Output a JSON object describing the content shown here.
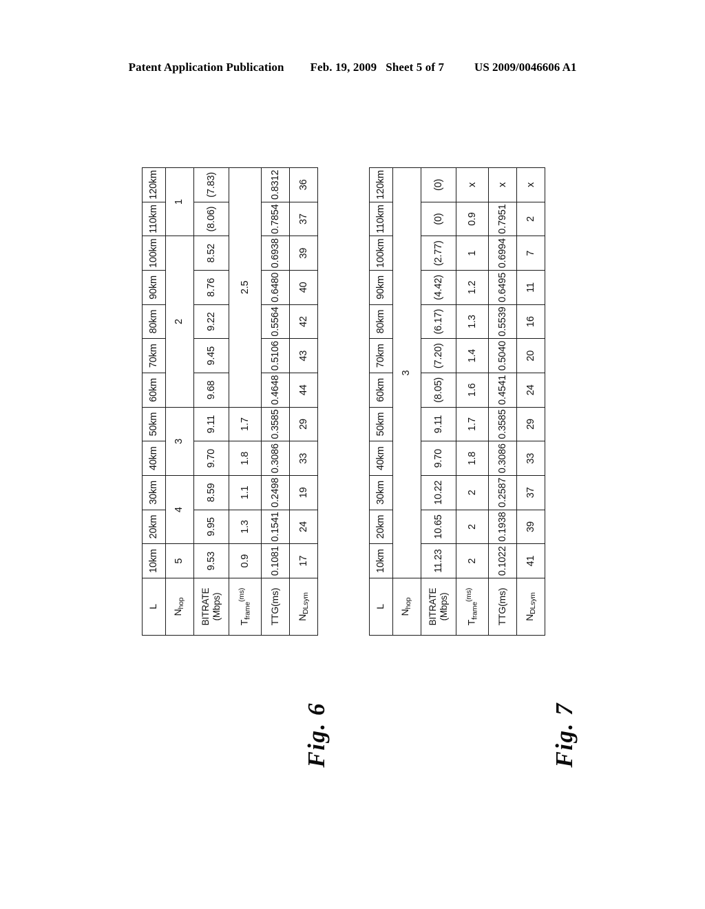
{
  "header": {
    "publication": "Patent Application Publication",
    "date": "Feb. 19, 2009",
    "sheet": "Sheet 5 of 7",
    "number": "US 2009/0046606 A1"
  },
  "figures": [
    {
      "id": "fig6",
      "caption": "Fig. 6",
      "corner_label": "L",
      "columns": [
        "10km",
        "20km",
        "30km",
        "40km",
        "50km",
        "60km",
        "70km",
        "80km",
        "90km",
        "100km",
        "110km",
        "120km"
      ],
      "rows": [
        {
          "key": "nhop",
          "label_main": "N",
          "label_sub": "hop",
          "label_sup": "",
          "merged": true,
          "cells": [
            {
              "value": "5",
              "span": 1
            },
            {
              "value": "4",
              "span": 2
            },
            {
              "value": "3",
              "span": 2
            },
            {
              "value": "2",
              "span": 5
            },
            {
              "value": "1",
              "span": 2
            }
          ]
        },
        {
          "key": "bitrate",
          "label_main": "BITRATE",
          "label_sub": "",
          "label_line2": "(Mbps)",
          "merged": false,
          "values": [
            "9.53",
            "9.95",
            "8.59",
            "9.70",
            "9.11",
            "9.68",
            "9.45",
            "9.22",
            "8.76",
            "8.52",
            "(8.06)",
            "(7.83)"
          ]
        },
        {
          "key": "tframe",
          "label_main": "T",
          "label_sub": "frame",
          "label_sup": "(ms)",
          "merged": true,
          "cells": [
            {
              "value": "0.9",
              "span": 1
            },
            {
              "value": "1.3",
              "span": 1
            },
            {
              "value": "1.1",
              "span": 1
            },
            {
              "value": "1.8",
              "span": 1
            },
            {
              "value": "1.7",
              "span": 1
            },
            {
              "value": "2.5",
              "span": 7
            }
          ]
        },
        {
          "key": "ttg",
          "label_main": "TTG(ms)",
          "label_sub": "",
          "merged": false,
          "values": [
            "0.1081",
            "0.1541",
            "0.2498",
            "0.3086",
            "0.3585",
            "0.4648",
            "0.5106",
            "0.5564",
            "0.6480",
            "0.6938",
            "0.7854",
            "0.8312"
          ]
        },
        {
          "key": "ndlsym",
          "label_main": "N",
          "label_sub": "DLsym",
          "merged": false,
          "values": [
            "17",
            "24",
            "19",
            "33",
            "29",
            "44",
            "43",
            "42",
            "40",
            "39",
            "37",
            "36"
          ]
        }
      ]
    },
    {
      "id": "fig7",
      "caption": "Fig. 7",
      "corner_label": "L",
      "columns": [
        "10km",
        "20km",
        "30km",
        "40km",
        "50km",
        "60km",
        "70km",
        "80km",
        "90km",
        "100km",
        "110km",
        "120km"
      ],
      "rows": [
        {
          "key": "nhop",
          "label_main": "N",
          "label_sub": "hop",
          "label_sup": "",
          "merged": true,
          "cells": [
            {
              "value": "3",
              "span": 12
            }
          ]
        },
        {
          "key": "bitrate",
          "label_main": "BITRATE",
          "label_sub": "",
          "label_line2": "(Mbps)",
          "merged": false,
          "values": [
            "11.23",
            "10.65",
            "10.22",
            "9.70",
            "9.11",
            "(8.05)",
            "(7.20)",
            "(6.17)",
            "(4.42)",
            "(2.77)",
            "(0)",
            "(0)"
          ]
        },
        {
          "key": "tframe",
          "label_main": "T",
          "label_sub": "frame",
          "label_sup": "(ms)",
          "merged": false,
          "values": [
            "2",
            "2",
            "2",
            "1.8",
            "1.7",
            "1.6",
            "1.4",
            "1.3",
            "1.2",
            "1",
            "0.9",
            "x"
          ]
        },
        {
          "key": "ttg",
          "label_main": "TTG(ms)",
          "label_sub": "",
          "merged": false,
          "values": [
            "0.1022",
            "0.1938",
            "0.2587",
            "0.3086",
            "0.3585",
            "0.4541",
            "0.5040",
            "0.5539",
            "0.6495",
            "0.6994",
            "0.7951",
            "x"
          ]
        },
        {
          "key": "ndlsym",
          "label_main": "N",
          "label_sub": "DLsym",
          "merged": false,
          "values": [
            "41",
            "39",
            "37",
            "33",
            "29",
            "24",
            "20",
            "16",
            "11",
            "7",
            "2",
            "x"
          ]
        }
      ]
    }
  ]
}
